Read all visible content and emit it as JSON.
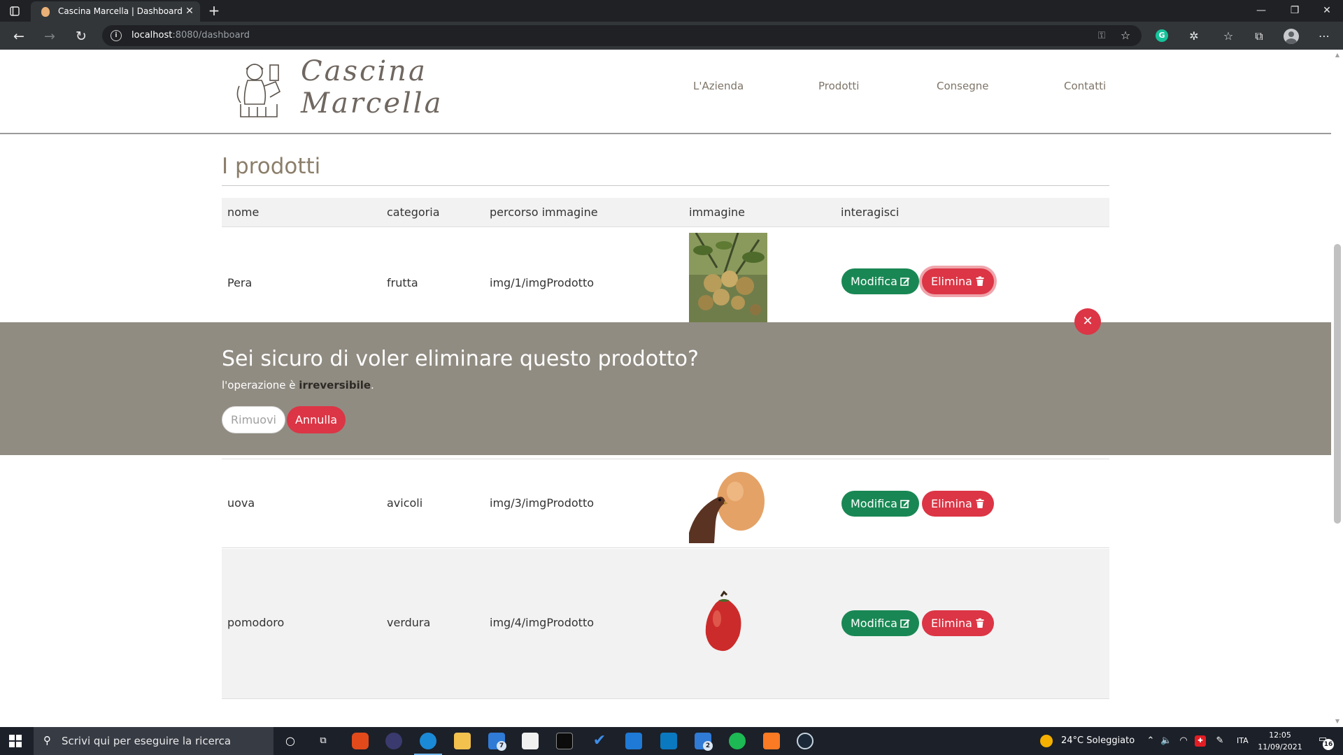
{
  "browser": {
    "tab_title": "Cascina Marcella | Dashboard",
    "url_host": "localhost",
    "url_path": ":8080/dashboard"
  },
  "site": {
    "logo_line1": "Cascina",
    "logo_line2": "Marcella",
    "nav": [
      "L'Azienda",
      "Prodotti",
      "Consegne",
      "Contatti"
    ]
  },
  "page": {
    "title": "I prodotti",
    "columns": [
      "nome",
      "categoria",
      "percorso immagine",
      "immagine",
      "interagisci"
    ],
    "rows": [
      {
        "nome": "Pera",
        "categoria": "frutta",
        "percorso": "img/1/imgProdotto",
        "image": "pear-tree-photo",
        "edit": "Modifica",
        "delete": "Elimina"
      },
      {
        "nome": "uova",
        "categoria": "avicoli",
        "percorso": "img/3/imgProdotto",
        "image": "egg-hen-photo",
        "edit": "Modifica",
        "delete": "Elimina"
      },
      {
        "nome": "pomodoro",
        "categoria": "verdura",
        "percorso": "img/4/imgProdotto",
        "image": "tomato-photo",
        "edit": "Modifica",
        "delete": "Elimina"
      }
    ]
  },
  "modal": {
    "title": "Sei sicuro di voler eliminare questo prodotto?",
    "text_pre": "l'operazione è ",
    "text_bold": "irreversibile",
    "text_post": ".",
    "confirm": "Rimuovi",
    "cancel": "Annulla"
  },
  "taskbar": {
    "search_placeholder": "Scrivi qui per eseguire la ricerca",
    "weather": "24°C  Soleggiato",
    "lang": "ITA",
    "time": "12:05",
    "date": "11/09/2021",
    "notifications": "16",
    "badges": {
      "mail": "7",
      "app2": "2"
    }
  },
  "colors": {
    "accent_green": "#198754",
    "accent_red": "#dc3545",
    "modal_bg": "#918c82",
    "title_brown": "#8b7e6a"
  }
}
